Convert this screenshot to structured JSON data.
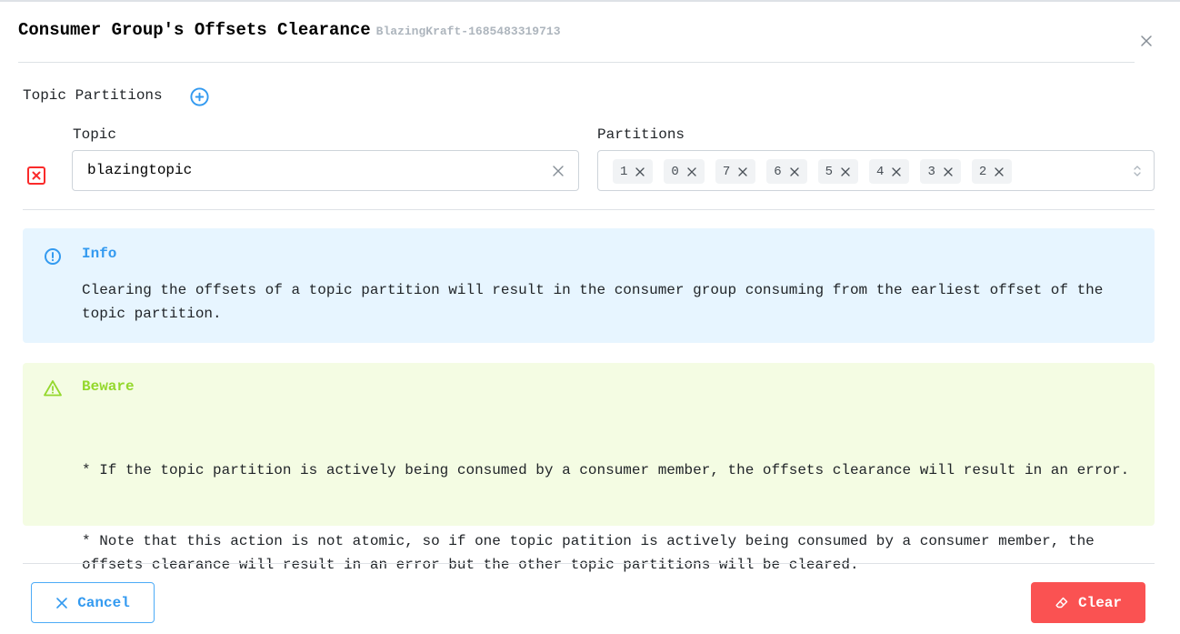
{
  "modal": {
    "title": "Consumer Group's Offsets Clearance",
    "subtitle": "BlazingKraft-1685483319713",
    "close_icon": "close-icon"
  },
  "topic_partitions": {
    "label": "Topic Partitions",
    "add_icon": "plus-circle-icon",
    "rows": [
      {
        "remove_icon": "square-x-icon",
        "topic_label": "Topic",
        "topic_value": "blazingtopic",
        "partitions_label": "Partitions",
        "partitions": [
          "1",
          "0",
          "7",
          "6",
          "5",
          "4",
          "3",
          "2"
        ]
      }
    ]
  },
  "alerts": {
    "info": {
      "icon": "alert-circle-icon",
      "title": "Info",
      "body": "Clearing the offsets of a topic partition will result in the consumer group consuming from the earliest offset of the topic partition.",
      "color": "#339af0"
    },
    "warn": {
      "icon": "alert-triangle-icon",
      "title": "Beware",
      "body_lines": [
        "* If the topic partition is actively being consumed by a consumer member, the offsets clearance will result in an error.",
        "* Note that this action is not atomic, so if one topic patition is actively being consumed by a consumer member, the offsets clearance will result in an error but the other topic partitions will be cleared."
      ],
      "color": "#94d82d"
    }
  },
  "footer": {
    "cancel_label": "Cancel",
    "clear_label": "Clear",
    "clear_color": "#fa5252"
  }
}
